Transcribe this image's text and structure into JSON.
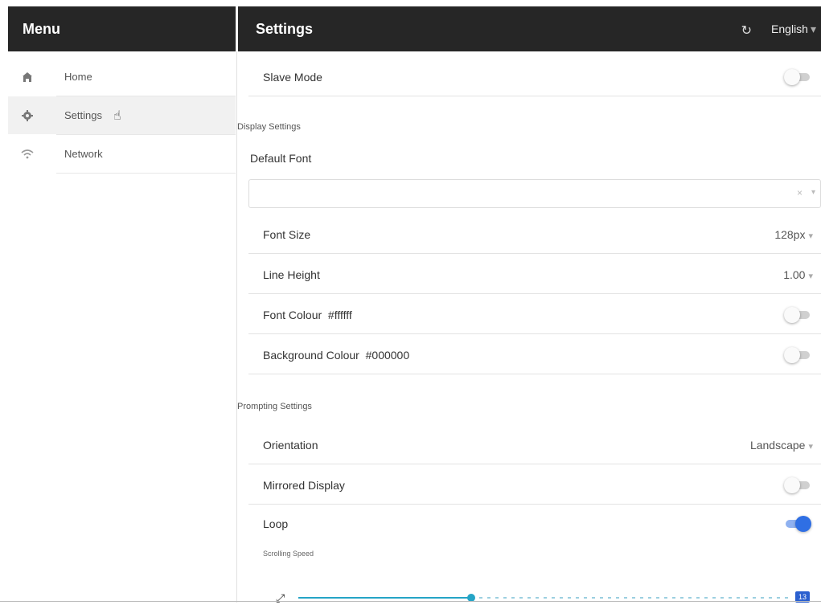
{
  "menu": {
    "title": "Menu",
    "items": [
      {
        "label": "Home",
        "icon": "home-icon"
      },
      {
        "label": "Settings",
        "icon": "gear-icon"
      },
      {
        "label": "Network",
        "icon": "wifi-icon"
      }
    ]
  },
  "header": {
    "title": "Settings",
    "language": "English"
  },
  "settings": {
    "slave_mode": {
      "label": "Slave Mode",
      "enabled": false
    },
    "display_section": "Display Settings",
    "default_font": {
      "label": "Default Font",
      "value": ""
    },
    "font_size": {
      "label": "Font Size",
      "value": "128px"
    },
    "line_height": {
      "label": "Line Height",
      "value": "1.00"
    },
    "font_colour": {
      "label": "Font Colour  #ffffff",
      "enabled": false
    },
    "background_colour": {
      "label": "Background Colour  #000000",
      "enabled": false
    },
    "prompting_section": "Prompting Settings",
    "orientation": {
      "label": "Orientation",
      "value": "Landscape"
    },
    "mirrored_display": {
      "label": "Mirrored Display",
      "enabled": false
    },
    "loop": {
      "label": "Loop",
      "enabled": true
    },
    "scrolling_speed": {
      "label": "Scrolling Speed",
      "value": "13",
      "fraction": 0.35
    }
  },
  "colors": {
    "header_bg": "#262626",
    "toggle_on": "#2f6fe4",
    "slider_accent": "#25a4c6"
  }
}
